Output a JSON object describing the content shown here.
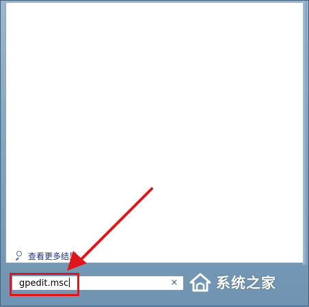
{
  "results": {
    "see_more_label": "查看更多结果",
    "search_icon": "search-icon"
  },
  "search": {
    "value": "gpedit.msc",
    "clear_label": "×",
    "clear_icon": "close-icon"
  },
  "annotation": {
    "color": "#e0161c",
    "arrow_icon": "arrow-icon"
  },
  "watermark": {
    "text": "系统之家",
    "logo_icon": "house-logo-icon",
    "color": "#ffffff"
  },
  "theme": {
    "frame_color": "#7ea2c0",
    "link_color": "#1e3287"
  }
}
